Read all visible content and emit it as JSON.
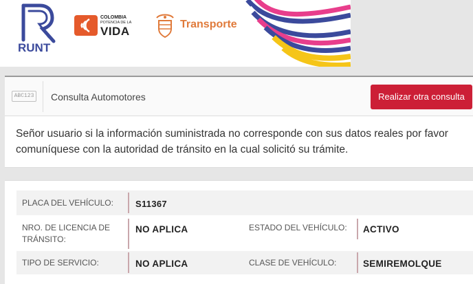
{
  "banner": {
    "runt_label": "RUNT",
    "colombia_line1": "COLOMBIA",
    "colombia_line2": "POTENCIA DE LA",
    "colombia_big": "VIDA",
    "transporte_label": "Transporte"
  },
  "header": {
    "icon_text": "ABC123",
    "title": "Consulta Automotores",
    "button_label": "Realizar otra consulta"
  },
  "notice": {
    "text": "Señor usuario si la información suministrada no corresponde con sus datos reales por favor comuníquese con la autoridad de tránsito en la cual solicitó su trámite."
  },
  "vehicle": {
    "placa_label": "PLACA DEL VEHÍCULO:",
    "placa_value": "S11367",
    "licencia_label_1": "NRO. DE LICENCIA DE",
    "licencia_label_2": "TRÁNSITO:",
    "licencia_value": "NO APLICA",
    "estado_label": "ESTADO DEL VEHÍCULO:",
    "estado_value": "ACTIVO",
    "servicio_label": "TIPO DE SERVICIO:",
    "servicio_value": "NO APLICA",
    "clase_label": "CLASE DE VEHÍCULO:",
    "clase_value": "SEMIREMOLQUE"
  },
  "colors": {
    "accent_red": "#cc1f36",
    "runt_blue": "#3b4a9c",
    "transporte_orange": "#e07a3a"
  }
}
